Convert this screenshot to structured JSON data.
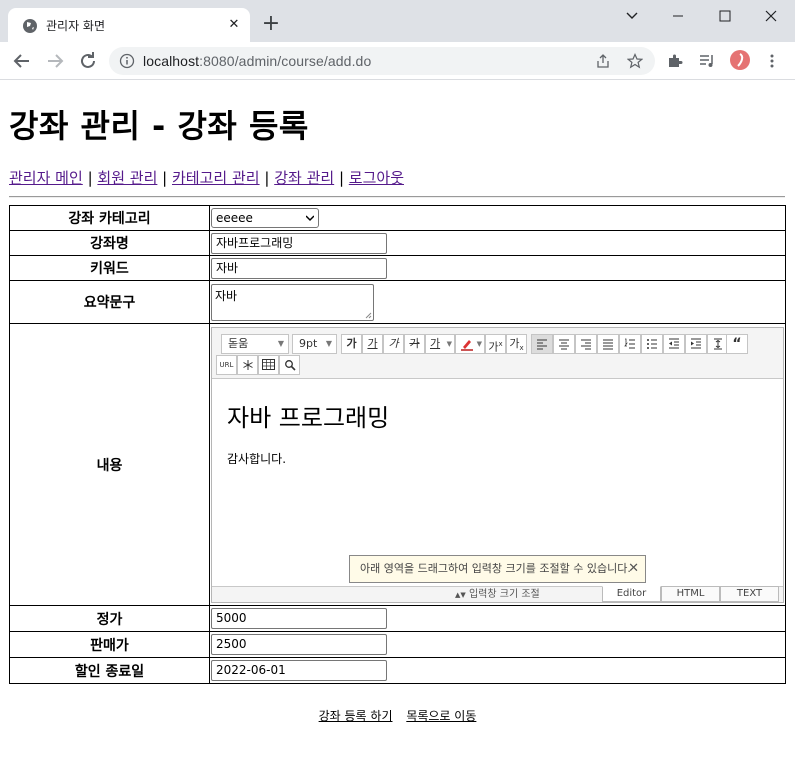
{
  "browser": {
    "tab_title": "관리자 화면",
    "url_host": "localhost",
    "url_rest": ":8080/admin/course/add.do"
  },
  "page": {
    "title": "강좌 관리 - 강좌 등록",
    "nav": [
      {
        "label": "관리자 메인"
      },
      {
        "label": "회원 관리"
      },
      {
        "label": "카테고리 관리"
      },
      {
        "label": "강좌 관리"
      },
      {
        "label": "로그아웃"
      }
    ],
    "separator": "|"
  },
  "form": {
    "category": {
      "label": "강좌 카테고리",
      "value": "eeeee"
    },
    "name": {
      "label": "강좌명",
      "value": "자바프로그래밍"
    },
    "keyword": {
      "label": "키워드",
      "value": "자바"
    },
    "summary": {
      "label": "요약문구",
      "value": "자바"
    },
    "content": {
      "label": "내용"
    },
    "price": {
      "label": "정가",
      "value": "5000"
    },
    "sale_price": {
      "label": "판매가",
      "value": "2500"
    },
    "sale_end": {
      "label": "할인 종료일",
      "value": "2022-06-01"
    }
  },
  "editor": {
    "font_family": "돋움",
    "font_size": "9pt",
    "buttons": {
      "bold": "가",
      "underline": "가",
      "italic": "가",
      "strike": "가",
      "font_color": "가",
      "superscript": "가",
      "subscript": "가",
      "url": "URL"
    },
    "heading": "자바 프로그래밍",
    "body_text": "감사합니다.",
    "tooltip": "아래 영역을 드래그하여 입력창 크기를 조절할 수 있습니다.",
    "resize_label": "입력창 크기 조절",
    "modes": [
      "Editor",
      "HTML",
      "TEXT"
    ]
  },
  "actions": {
    "submit": "강좌 등록 하기",
    "back_to_list": "목록으로 이동"
  }
}
